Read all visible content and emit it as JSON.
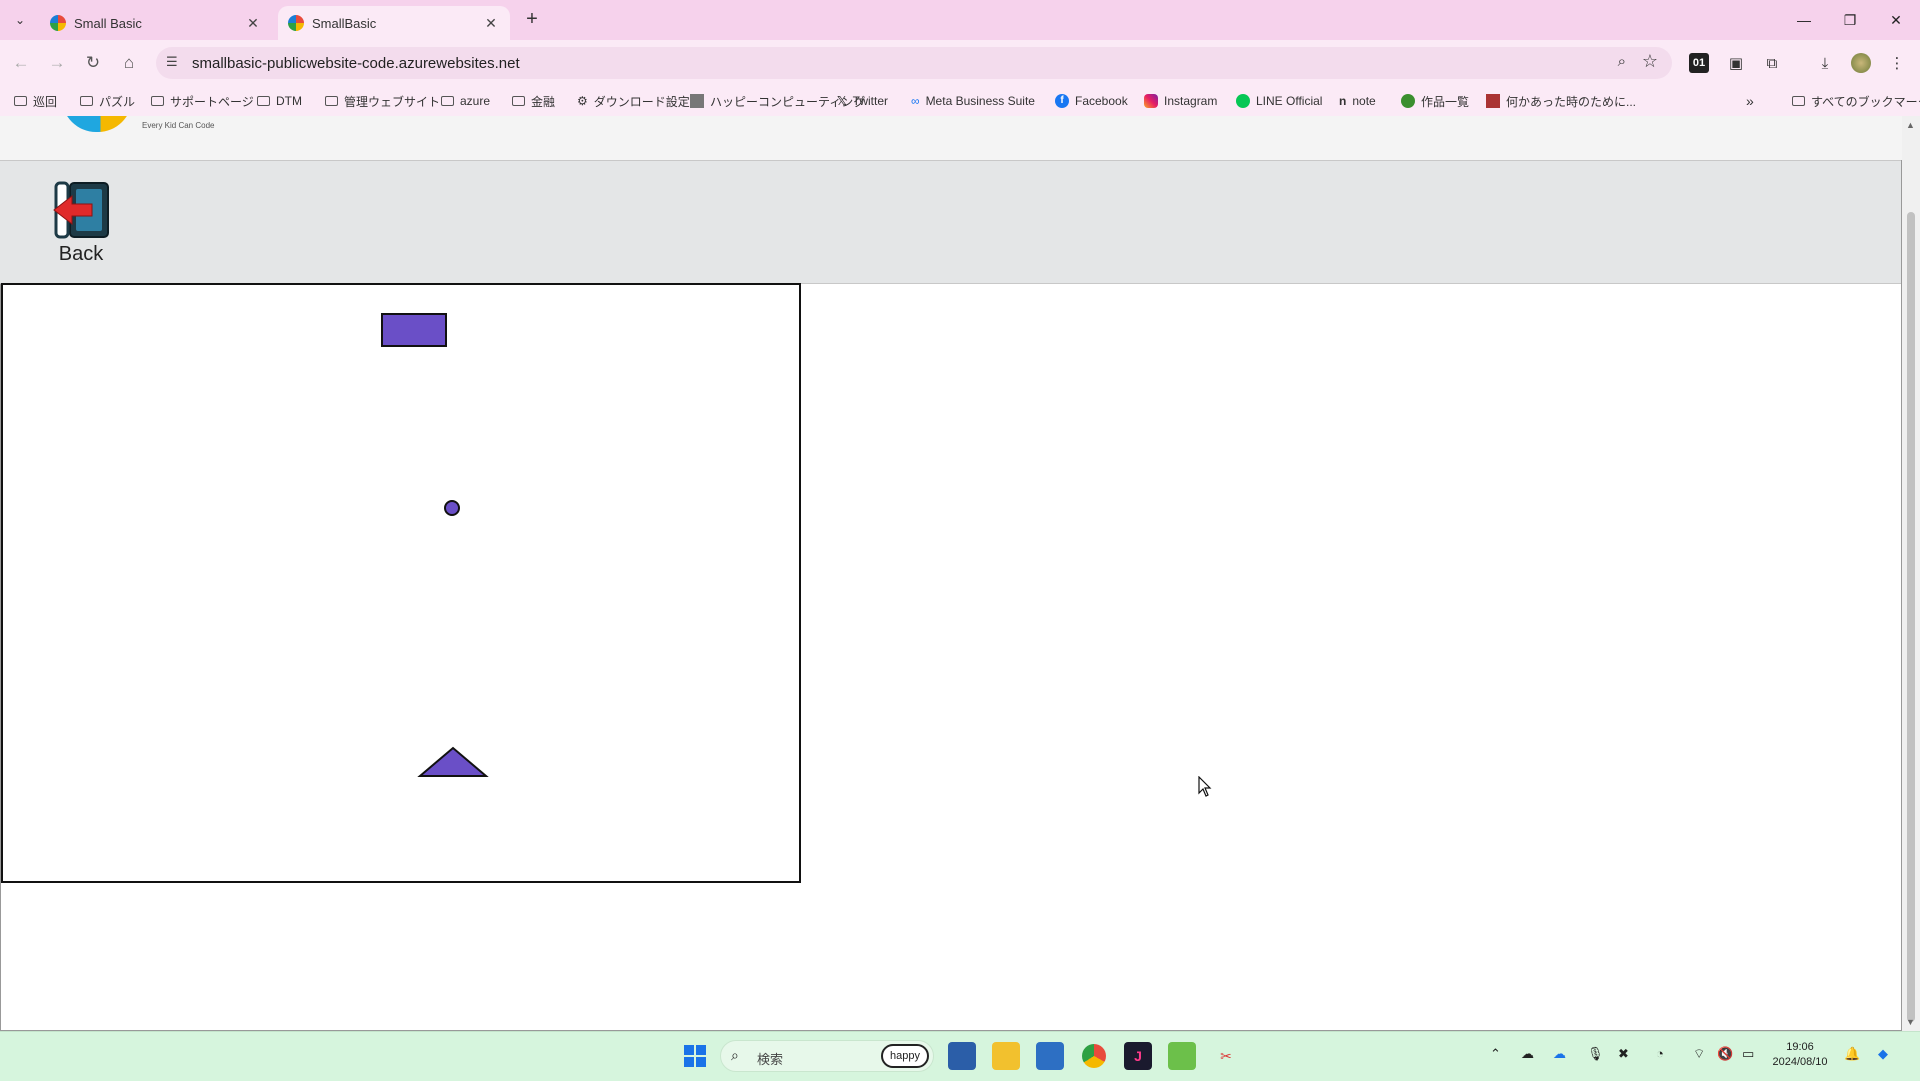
{
  "browser": {
    "tabs": [
      {
        "title": "Small Basic",
        "active": false
      },
      {
        "title": "SmallBasic",
        "active": true
      }
    ],
    "address": "smallbasic-publicwebsite-code.azurewebsites.net",
    "bookmarks": [
      {
        "label": "巡回",
        "icon": "folder-icon"
      },
      {
        "label": "パズル",
        "icon": "folder-icon"
      },
      {
        "label": "サポートページ",
        "icon": "folder-icon"
      },
      {
        "label": "DTM",
        "icon": "folder-icon"
      },
      {
        "label": "管理ウェブサイト",
        "icon": "folder-icon"
      },
      {
        "label": "azure",
        "icon": "folder-icon"
      },
      {
        "label": "金融",
        "icon": "folder-icon"
      },
      {
        "label": "ダウンロード設定",
        "icon": "gear-icon"
      },
      {
        "label": "ハッピーコンピューティング",
        "icon": "site-icon"
      },
      {
        "label": "Twitter",
        "icon": "x-icon"
      },
      {
        "label": "Meta Business Suite",
        "icon": "meta-icon"
      },
      {
        "label": "Facebook",
        "icon": "facebook-icon"
      },
      {
        "label": "Instagram",
        "icon": "instagram-icon"
      },
      {
        "label": "LINE Official",
        "icon": "line-icon"
      },
      {
        "label": "note",
        "icon": "note-icon"
      },
      {
        "label": "作品一覧",
        "icon": "site-icon"
      },
      {
        "label": "何かあった時のために...",
        "icon": "site-icon"
      }
    ],
    "all_bookmarks": "すべてのブックマーク"
  },
  "page": {
    "logo_tagline": "Every Kid Can Code",
    "back_label": "Back",
    "shape_color": "#6a4fc7"
  },
  "taskbar": {
    "search_placeholder": "検索",
    "search_badge": "happy",
    "time": "19:06",
    "date": "2024/08/10"
  }
}
